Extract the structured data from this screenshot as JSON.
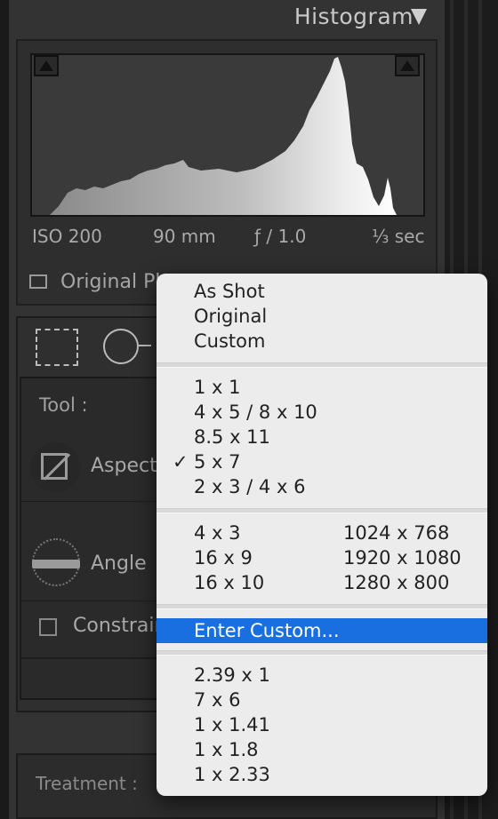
{
  "histogram": {
    "title": "Histogram",
    "exif": {
      "iso": "ISO 200",
      "focal": "90 mm",
      "aperture": "ƒ / 1.0",
      "shutter": "⅓ sec"
    },
    "original_photo_label": "Original Ph"
  },
  "tools": {
    "tool_label": "Tool :",
    "aspect_label": "Aspect",
    "angle_label": "Angle",
    "constrain_label": "Constrain",
    "treatment_label": "Treatment :"
  },
  "menu": {
    "group1": [
      "As Shot",
      "Original",
      "Custom"
    ],
    "group2": [
      "1 x 1",
      "4 x 5  /  8 x 10",
      "8.5 x 11",
      "5 x 7",
      "2 x 3  /  4 x 6"
    ],
    "checked_index": 3,
    "check_mark": "✓",
    "group3_left": [
      "4 x 3",
      "16 x 9",
      "16 x 10"
    ],
    "group3_right": [
      "1024 x 768",
      "1920 x 1080",
      "1280 x 800"
    ],
    "enter_custom": "Enter Custom...",
    "group4": [
      "2.39 x 1",
      "7 x 6",
      "1 x 1.41",
      "1 x 1.8",
      "1 x 2.33"
    ]
  },
  "colors": {
    "highlight": "#1a6fe0",
    "menu_bg": "#ececec"
  }
}
